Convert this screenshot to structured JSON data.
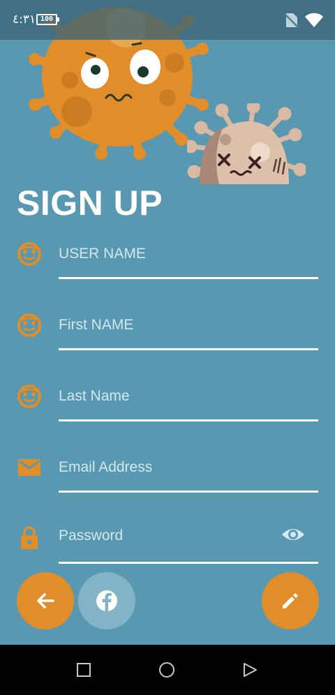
{
  "status_bar": {
    "time": "٤:٣١",
    "battery": "100"
  },
  "page": {
    "title": "SIGN UP"
  },
  "form": {
    "fields": [
      {
        "placeholder": "USER NAME",
        "icon": "face-icon"
      },
      {
        "placeholder": "First NAME",
        "icon": "face-icon"
      },
      {
        "placeholder": "Last Name",
        "icon": "face-icon"
      },
      {
        "placeholder": "Email Address",
        "icon": "mail-icon"
      },
      {
        "placeholder": "Password",
        "icon": "lock-icon"
      }
    ]
  },
  "actions": {
    "back": "arrow-back-icon",
    "facebook": "facebook-icon",
    "submit": "pencil-icon"
  },
  "colors": {
    "background": "#5898b0",
    "accent": "#e08d2a",
    "facebook_button": "#82b3c6"
  }
}
